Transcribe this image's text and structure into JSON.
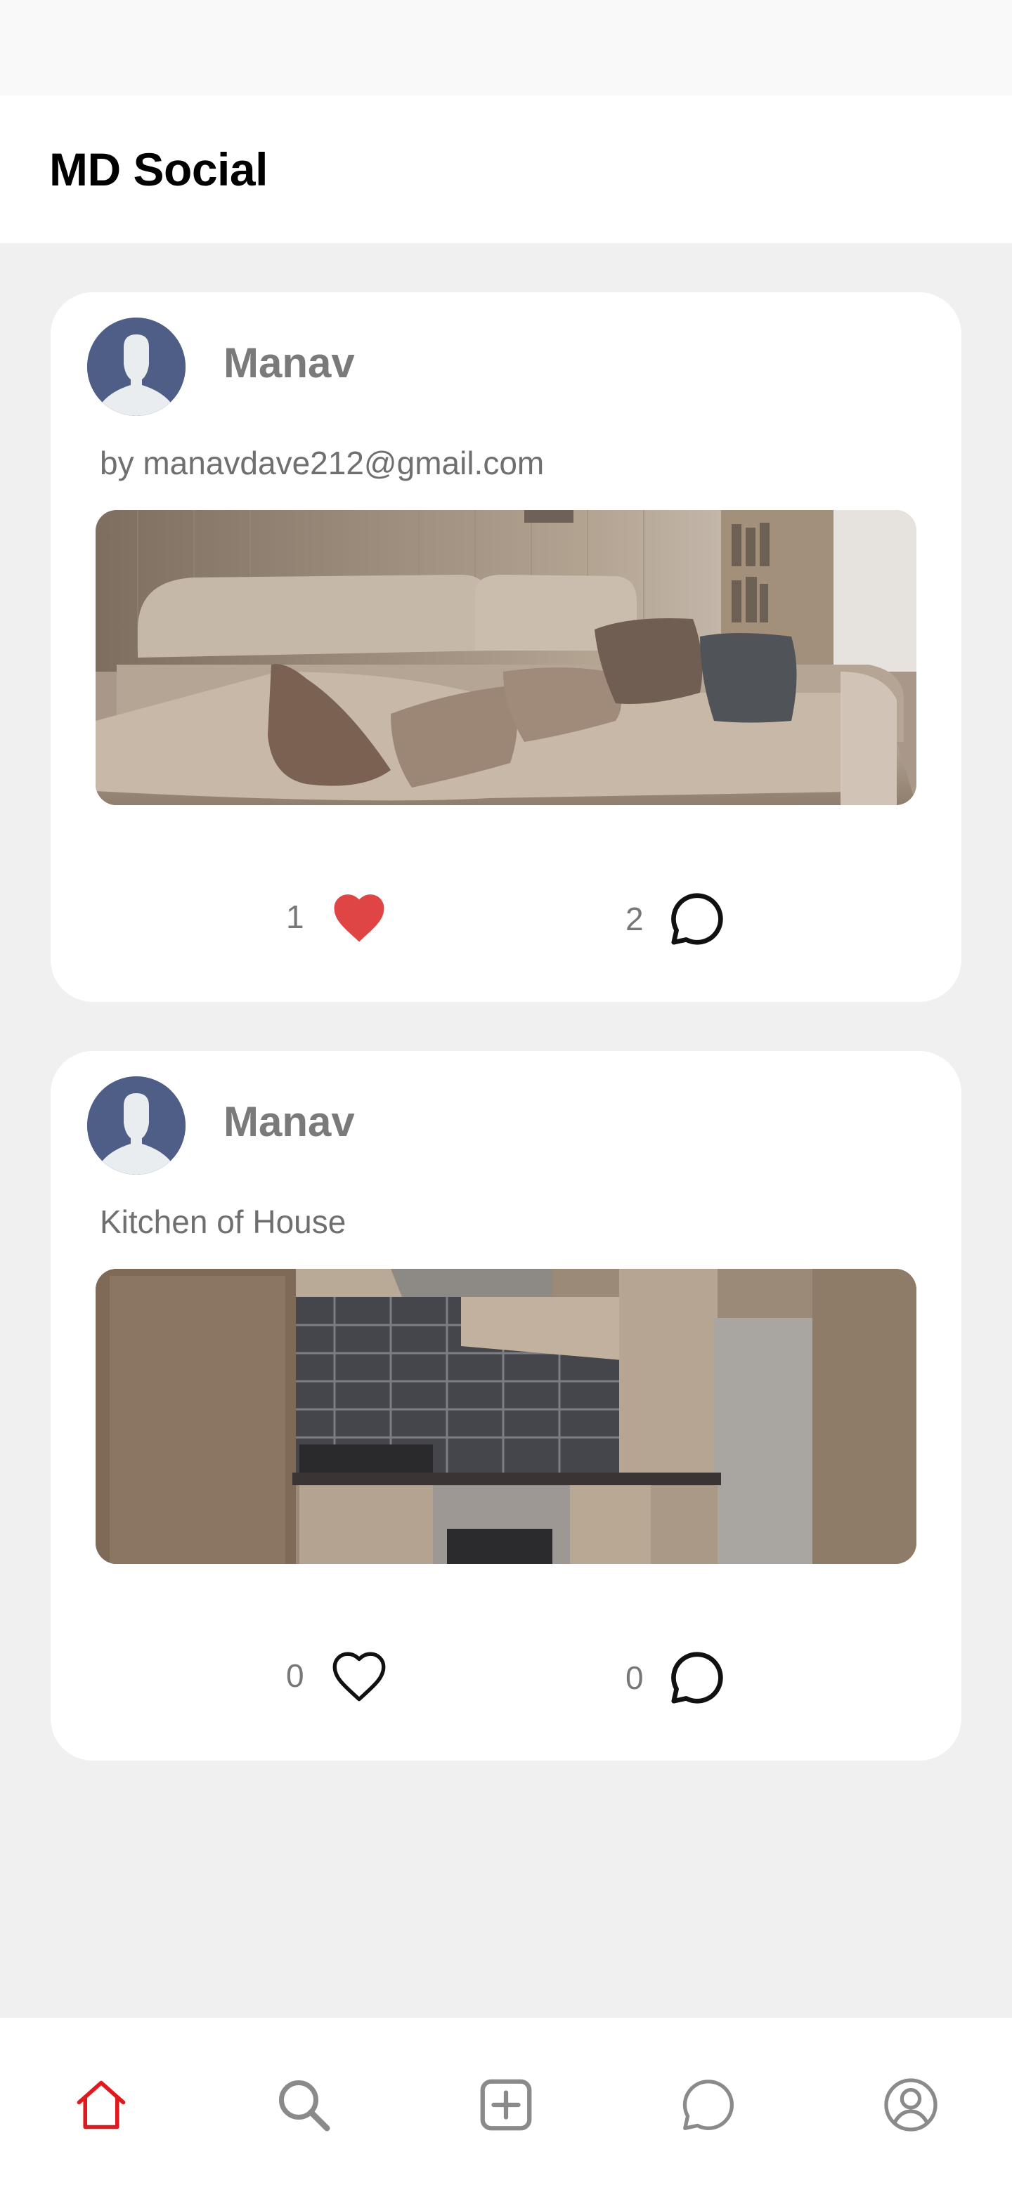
{
  "app": {
    "title": "MD Social"
  },
  "posts": [
    {
      "user": "Manav",
      "caption": "by manavdave212@gmail.com",
      "image": "living-room-sofa-photo",
      "likes": "1",
      "liked": true,
      "comments": "2"
    },
    {
      "user": "Manav",
      "caption": "Kitchen of House",
      "image": "kitchen-photo",
      "likes": "0",
      "liked": false,
      "comments": "0"
    }
  ],
  "nav": {
    "items": [
      "home-icon",
      "search-icon",
      "add-post-icon",
      "chat-icon",
      "profile-icon"
    ],
    "active": "home-icon"
  },
  "colors": {
    "accent": "#e0191f",
    "like": "#e04545",
    "avatar_bg": "#4f5e86",
    "icon_gray": "#8a8a8a"
  }
}
